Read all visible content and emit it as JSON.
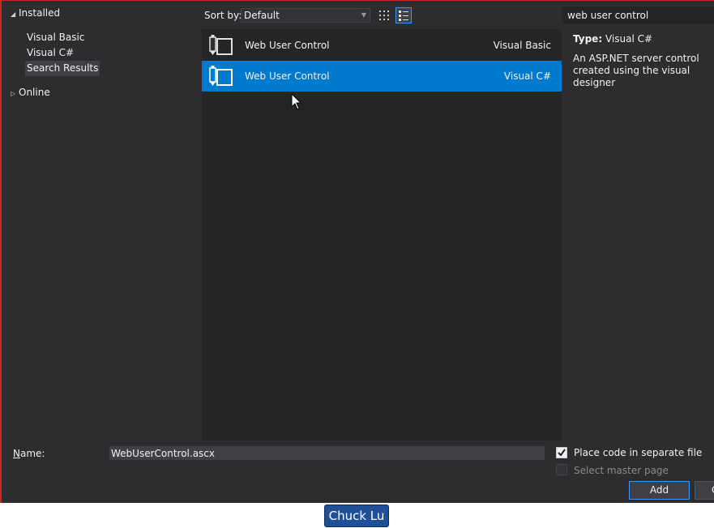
{
  "tree": {
    "installed": "Installed",
    "items": [
      "Visual Basic",
      "Visual C#",
      "Search Results"
    ],
    "online": "Online"
  },
  "toolbar": {
    "sort_label": "Sort by:",
    "sort_value": "Default"
  },
  "search": {
    "value": "web user control"
  },
  "templates": [
    {
      "name": "Web User Control",
      "language": "Visual Basic",
      "selected": false
    },
    {
      "name": "Web User Control",
      "language": "Visual C#",
      "selected": true
    }
  ],
  "description": {
    "type_label": "Type:",
    "type_value": "Visual C#",
    "text": "An ASP.NET server control created using the visual designer"
  },
  "bottom": {
    "name_label": "Name:",
    "name_value": "WebUserControl.ascx",
    "place_code": "Place code in separate file",
    "place_code_checked": true,
    "master_page": "Select master page",
    "master_page_checked": false,
    "add_label": "Add",
    "cancel_label": "C"
  },
  "watermark": "Chuck Lu",
  "colors": {
    "background": "#2d2d30",
    "list_background": "#252526",
    "selection": "#007acc",
    "accent_border": "#3399ff"
  }
}
